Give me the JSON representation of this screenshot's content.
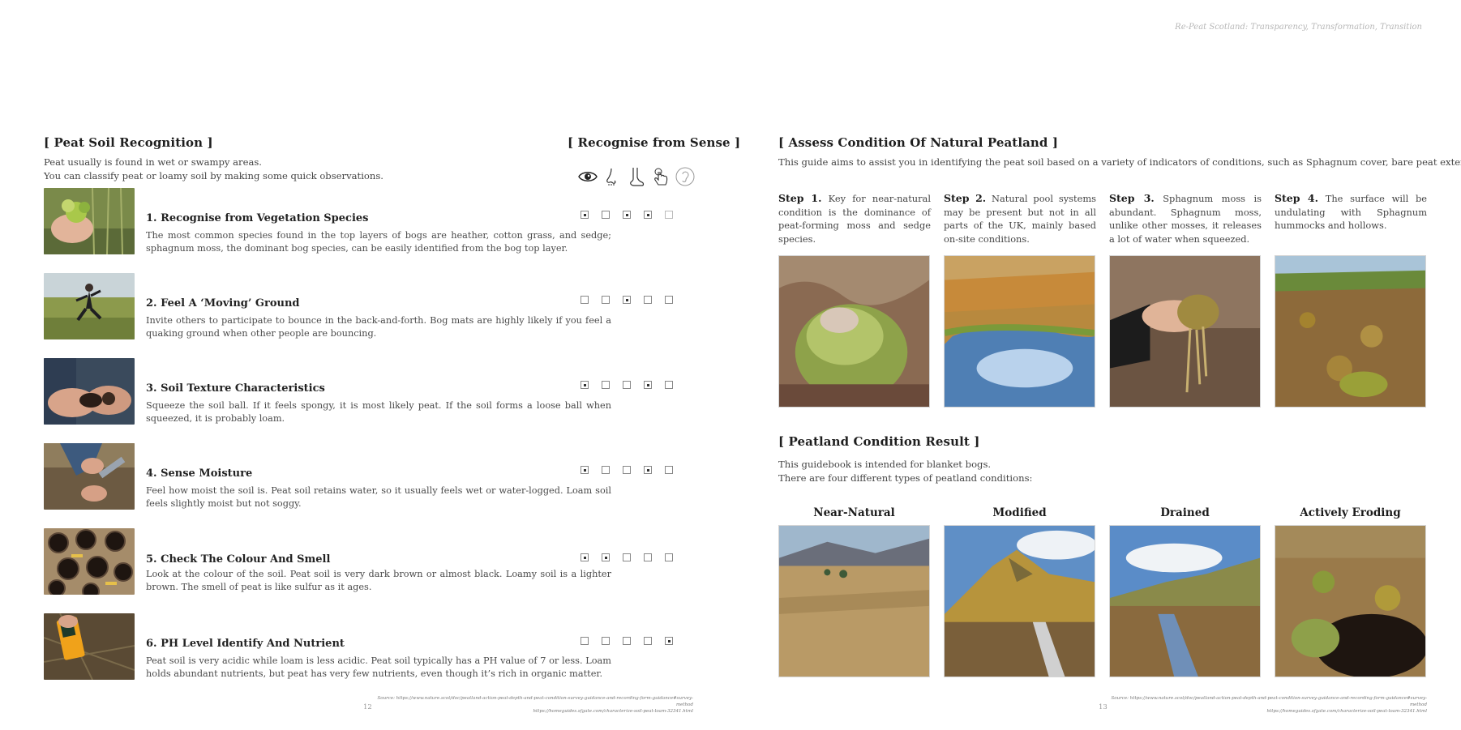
{
  "header_note": "Re-Peat Scotland: Transparency, Transformation, Transition",
  "left": {
    "title": "[ Peat Soil Recognition ]",
    "sense_title": "[ Recognise from Sense ]",
    "intro_line1": "Peat usually is found in wet or swampy areas.",
    "intro_line2": "You can classify peat or loamy soil by making some quick observations.",
    "senses": [
      "eye-icon",
      "nose-icon",
      "foot-icon",
      "hand-touch-icon",
      "ear-icon"
    ],
    "items": [
      {
        "title": "1. Recognise from Vegetation Species",
        "desc": "The most common species found in the top layers of bogs are heather, cotton grass, and sedge; sphagnum moss, the dominant bog species, can be easily identified from the bog top layer.",
        "checks": [
          true,
          false,
          true,
          true,
          false
        ]
      },
      {
        "title": "2. Feel A ‘Moving’ Ground",
        "desc": "Invite others to participate to bounce in the back-and-forth. Bog mats are highly likely if you feel a quaking ground when other people are bouncing.",
        "checks": [
          false,
          false,
          true,
          false,
          false
        ]
      },
      {
        "title": "3. Soil Texture Characteristics",
        "desc": "Squeeze the soil ball. If it feels spongy, it is most likely peat. If the soil forms a loose ball when squeezed, it is probably loam.",
        "checks": [
          true,
          false,
          false,
          true,
          false
        ]
      },
      {
        "title": "4. Sense Moisture",
        "desc": "Feel how moist the soil is. Peat soil retains water, so it usually feels wet or water-logged. Loam soil feels slightly moist but not soggy.",
        "checks": [
          true,
          false,
          false,
          true,
          false
        ]
      },
      {
        "title": "5. Check The Colour And Smell",
        "desc": "Look at the colour of the soil. Peat soil is very dark brown or almost black. Loamy soil is a lighter brown. The smell of peat is like sulfur as it ages.",
        "checks": [
          true,
          true,
          false,
          false,
          false
        ]
      },
      {
        "title": "6. PH Level Identify And Nutrient",
        "desc": "Peat soil is very acidic while loam is less acidic. Peat soil typically has a PH value of 7 or less. Loam holds abundant nutrients,  but peat has very few nutrients, even though it’s rich in organic matter.",
        "checks": [
          false,
          false,
          false,
          false,
          true
        ]
      }
    ],
    "source_line1": "Source: https://www.nature.scot/doc/peatland-action-peat-depth-and-peat-condition-survey-guidance-and-recording-form-guidance#survey-method",
    "source_line2": "https://homeguides.sfgate.com/characterize-soil-peat-loam-32341.html",
    "page_number": "12"
  },
  "right": {
    "assess_title": "[ Assess Condition Of Natural Peatland ]",
    "assess_intro": "This guide aims to assist you in identifying the peat soil based on a variety of indicators of conditions, such as Sphagnum cover, bare peat extent, etc...",
    "steps": [
      {
        "label": "Step 1.",
        "text": "Key for near-natural condition is the dominance of peat-forming moss and sedge species."
      },
      {
        "label": "Step 2.",
        "text": "Natural pool systems may be present but not in all parts of the UK, mainly based on-site conditions."
      },
      {
        "label": "Step 3.",
        "text": "Sphagnum moss is abundant. Sphagnum moss, unlike other mosses, it releases a lot of water when squeezed."
      },
      {
        "label": "Step 4.",
        "text": "The surface will be undulating with Sphagnum hummocks and hollows."
      }
    ],
    "result_title": "[ Peatland  Condition Result ]",
    "result_line1": "This guidebook is intended for blanket bogs.",
    "result_line2": "There are four different types of peatland conditions:",
    "conditions": [
      "Near-Natural",
      "Modified",
      "Drained",
      "Actively Eroding"
    ],
    "source_line1": "Source: https://www.nature.scot/doc/peatland-action-peat-depth-and-peat-condition-survey-guidance-and-recording-form-guidance#survey-method",
    "source_line2": "https://homeguides.sfgate.com/characterize-soil-peat-loam-32341.html",
    "page_number": "13"
  }
}
